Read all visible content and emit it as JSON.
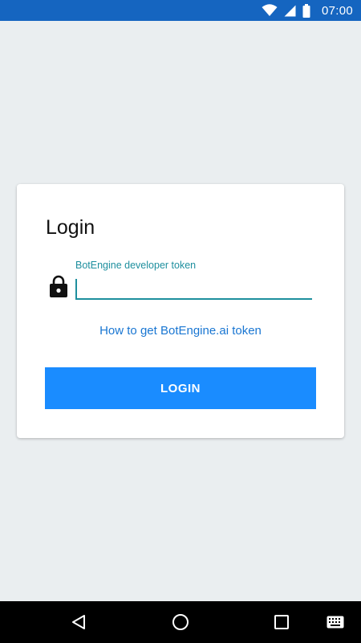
{
  "status_bar": {
    "time": "07:00",
    "icons": [
      "wifi-icon",
      "cell-signal-icon",
      "battery-icon"
    ],
    "background": "#1565c0"
  },
  "login_card": {
    "title": "Login",
    "token_field": {
      "label": "BotEngine developer token",
      "value": "",
      "placeholder": ""
    },
    "help_link": "How to get BotEngine.ai token",
    "login_button": "LOGIN"
  },
  "nav_bar": {
    "icons": [
      "back-icon",
      "home-icon",
      "recents-icon",
      "keyboard-icon"
    ]
  },
  "colors": {
    "accent": "#1e8f9e",
    "link": "#1976d2",
    "button": "#1a8cff",
    "background": "#eaeef0"
  }
}
